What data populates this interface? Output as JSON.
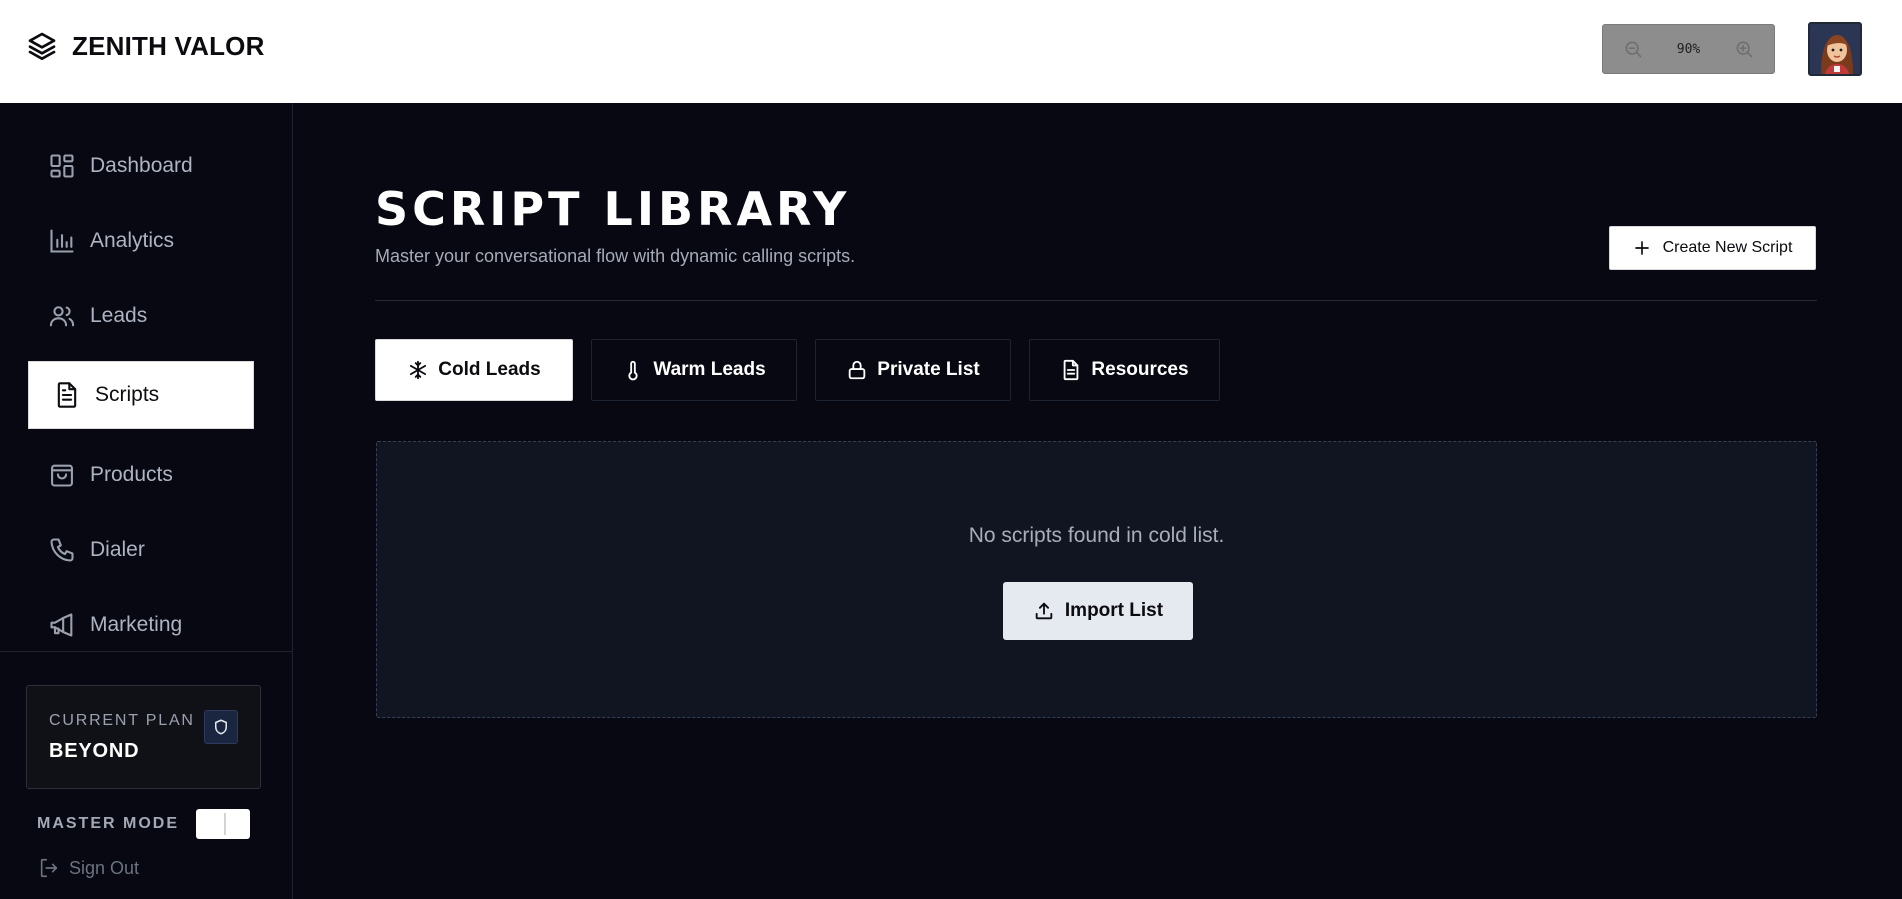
{
  "brand": {
    "name": "ZENITH VALOR",
    "icon": "layers-icon"
  },
  "zoom": {
    "level": "90%",
    "out_icon": "zoom-out-icon",
    "in_icon": "zoom-in-icon"
  },
  "sidebar": {
    "items": [
      {
        "label": "Dashboard",
        "icon": "dashboard-icon",
        "active": false
      },
      {
        "label": "Analytics",
        "icon": "bar-chart-icon",
        "active": false
      },
      {
        "label": "Leads",
        "icon": "users-icon",
        "active": false
      },
      {
        "label": "Scripts",
        "icon": "file-text-icon",
        "active": true
      },
      {
        "label": "Products",
        "icon": "shopping-bag-icon",
        "active": false
      },
      {
        "label": "Dialer",
        "icon": "phone-icon",
        "active": false
      },
      {
        "label": "Marketing",
        "icon": "megaphone-icon",
        "active": false
      }
    ],
    "plan": {
      "label": "CURRENT PLAN",
      "name": "BEYOND",
      "icon": "shield-icon"
    },
    "master_mode": {
      "label": "MASTER MODE",
      "enabled": true
    },
    "sign_out": {
      "label": "Sign Out",
      "icon": "log-out-icon"
    }
  },
  "main": {
    "title": "SCRIPT LIBRARY",
    "subtitle": "Master your conversational flow with dynamic calling scripts.",
    "create_button": "Create New Script",
    "tabs": [
      {
        "label": "Cold Leads",
        "icon": "snowflake-icon",
        "active": true
      },
      {
        "label": "Warm Leads",
        "icon": "thermometer-icon",
        "active": false
      },
      {
        "label": "Private List",
        "icon": "lock-icon",
        "active": false
      },
      {
        "label": "Resources",
        "icon": "file-text-icon",
        "active": false
      }
    ],
    "empty_state": {
      "message": "No scripts found in cold list.",
      "import_button": "Import List"
    }
  },
  "colors": {
    "background": "#070811",
    "panel": "#111521",
    "accent_light": "#ffffff",
    "muted_text": "#a5abb8"
  }
}
